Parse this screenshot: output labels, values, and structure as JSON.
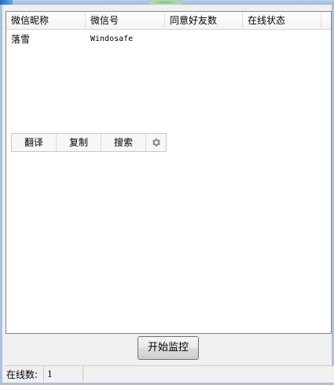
{
  "list": {
    "columns": [
      "微信昵称",
      "微信号",
      "同意好友数",
      "在线状态"
    ],
    "rows": [
      {
        "nickname": "落雪",
        "wechat_id": "Windosafe",
        "friends": "",
        "status": ""
      }
    ]
  },
  "toolbar": {
    "translate_label": "翻译",
    "copy_label": "复制",
    "search_label": "搜索",
    "settings_icon": "gear-icon"
  },
  "actions": {
    "start_label": "开始监控"
  },
  "statusbar": {
    "online_label": "在线数:",
    "online_count": "1"
  },
  "colors": {
    "frame": "#a9c2dd",
    "list_bg": "#ffffff",
    "window_bg": "#f0f0f0"
  }
}
